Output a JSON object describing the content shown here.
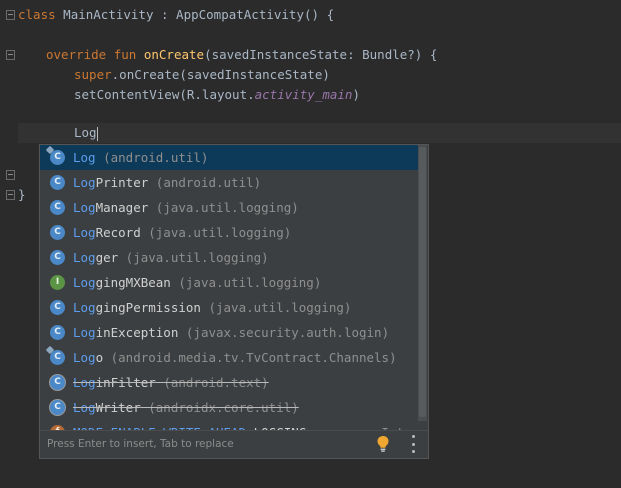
{
  "editor": {
    "lines": {
      "class_kw": "class",
      "class_name": " MainActivity : AppCompatActivity() {",
      "override_kw": "override",
      "fun_kw": "fun",
      "on_create_fn": "onCreate",
      "on_create_params": "(savedInstanceState: Bundle?) {",
      "super_kw": "super",
      "super_call": ".onCreate(savedInstanceState)",
      "set_content_view": "setContentView(R.layout.",
      "activity_main": "activity_main",
      "close_paren": ")",
      "typed_text": "Log",
      "closing_brace": "}"
    }
  },
  "completion": {
    "items": [
      {
        "icon": "class-icon",
        "match": "Log",
        "rest": "",
        "location": " (android.util)",
        "selected": true,
        "strike": false
      },
      {
        "icon": "class-icon",
        "match": "Log",
        "rest": "Printer",
        "location": " (android.util)",
        "selected": false,
        "strike": false
      },
      {
        "icon": "class-icon",
        "match": "Log",
        "rest": "Manager",
        "location": " (java.util.logging)",
        "selected": false,
        "strike": false
      },
      {
        "icon": "class-icon",
        "match": "Log",
        "rest": "Record",
        "location": " (java.util.logging)",
        "selected": false,
        "strike": false
      },
      {
        "icon": "class-icon",
        "match": "Log",
        "rest": "ger",
        "location": " (java.util.logging)",
        "selected": false,
        "strike": false
      },
      {
        "icon": "interface-icon",
        "match": "Log",
        "rest": "gingMXBean",
        "location": " (java.util.logging)",
        "selected": false,
        "strike": false
      },
      {
        "icon": "class-icon",
        "match": "Log",
        "rest": "gingPermission",
        "location": " (java.util.logging)",
        "selected": false,
        "strike": false
      },
      {
        "icon": "class-icon",
        "match": "Log",
        "rest": "inException",
        "location": " (javax.security.auth.login)",
        "selected": false,
        "strike": false
      },
      {
        "icon": "class-icon",
        "match": "Log",
        "rest": "o",
        "location": " (android.media.tv.TvContract.Channels)",
        "selected": false,
        "strike": false
      },
      {
        "icon": "class-icon",
        "match": "Log",
        "rest": "inFilter",
        "location": " (android.text)",
        "selected": false,
        "strike": true
      },
      {
        "icon": "class-icon",
        "match": "Log",
        "rest": "Writer",
        "location": " (androidx.core.util)",
        "selected": false,
        "strike": true
      },
      {
        "icon": "method-icon",
        "match": "MODE_ENABLE_WRITE_AHEAD_",
        "rest": "LOGGING",
        "location": "",
        "type": "Int",
        "selected": false,
        "strike": false
      }
    ],
    "footer_hint": "Press Enter to insert, Tab to replace"
  }
}
